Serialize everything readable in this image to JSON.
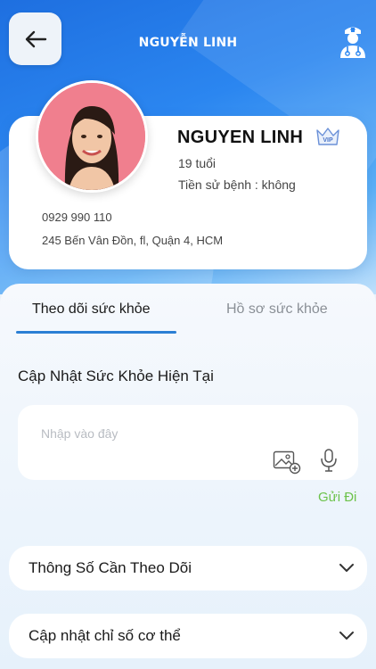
{
  "header": {
    "title": "NGUYỄN LINH"
  },
  "profile": {
    "name": "NGUYEN LINH",
    "badge": "VIP",
    "age": "19 tuổi",
    "medical_history": "Tiền sử bệnh : không",
    "phone": "0929 990 110",
    "address": "245 Bến Vân Đồn, fl, Quận 4, HCM"
  },
  "tabs": [
    {
      "label": "Theo dõi sức khỏe",
      "active": true
    },
    {
      "label": "Hồ sơ sức khỏe",
      "active": false
    }
  ],
  "update_section": {
    "title": "Cập Nhật Sức Khỏe Hiện Tại",
    "placeholder": "Nhập vào đây",
    "send_label": "Gửi Đi"
  },
  "accordions": [
    {
      "label": "Thông Số Cần Theo Dõi"
    },
    {
      "label": "Cập nhật chỉ số cơ thể"
    }
  ],
  "colors": {
    "primary": "#2b7fd4",
    "send_green": "#6cc24a",
    "avatar_bg": "#f07f8e"
  },
  "icons": {
    "back": "arrow-left-icon",
    "doctor": "doctor-icon",
    "vip": "vip-crown-icon",
    "image": "add-image-icon",
    "mic": "microphone-icon",
    "chevron": "chevron-down-icon"
  }
}
